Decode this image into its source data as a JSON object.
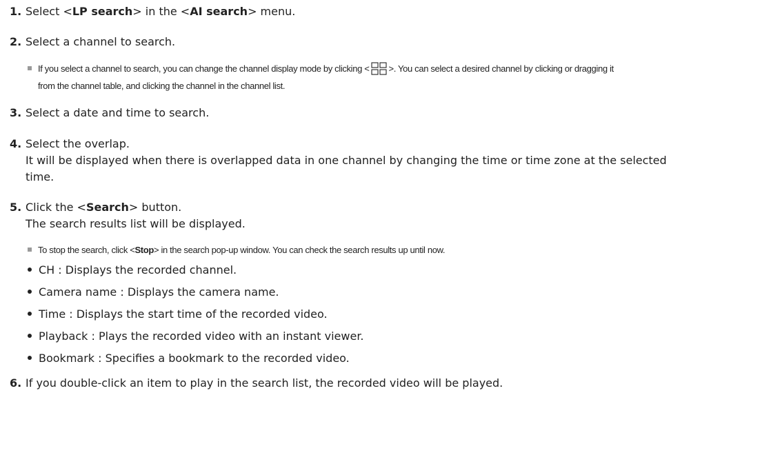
{
  "steps": [
    {
      "num": "1.",
      "pre": "Select <",
      "b1": "LP search",
      "mid": "> in the <",
      "b2": "AI search",
      "post": "> menu."
    },
    {
      "num": "2.",
      "text": "Select a channel to search."
    },
    {
      "num": "3.",
      "text": "Select a date and time to search."
    },
    {
      "num": "4.",
      "text": "Select the overlap.",
      "desc_line1": "It will be displayed when there is overlapped data in one channel by changing the time or time zone at the selected",
      "desc_line2": "time."
    },
    {
      "num": "5.",
      "pre": "Click the <",
      "b1": "Search",
      "post": "> button.",
      "desc": "The search results list will be displayed."
    },
    {
      "num": "6.",
      "text": "If you double-click an item to play in the search list, the recorded video will be played."
    }
  ],
  "notes": {
    "channel_pre": "If you select a channel to search, you can change the channel display mode by clicking <",
    "channel_post": ">. You can select a desired channel by clicking or dragging it",
    "channel_line2": "from the channel table, and clicking the channel in the channel list.",
    "stop_pre": "To stop the search, click <",
    "stop_bold": "Stop",
    "stop_post": "> in the search pop-up window. You can check the search results up until now."
  },
  "bullets": [
    "CH : Displays the recorded channel.",
    "Camera name : Displays the camera name.",
    "Time : Displays the start time of the recorded video.",
    "Playback : Plays the recorded video with an instant viewer.",
    "Bookmark : Specifies a bookmark to the recorded video."
  ],
  "icons": {
    "channel_display_mode": "four-square-grid-icon",
    "note_marker": "grey-square-bullet",
    "list_marker": "black-dot-bullet"
  },
  "colors": {
    "text": "#222222",
    "note_marker": "#9a9a9a"
  }
}
